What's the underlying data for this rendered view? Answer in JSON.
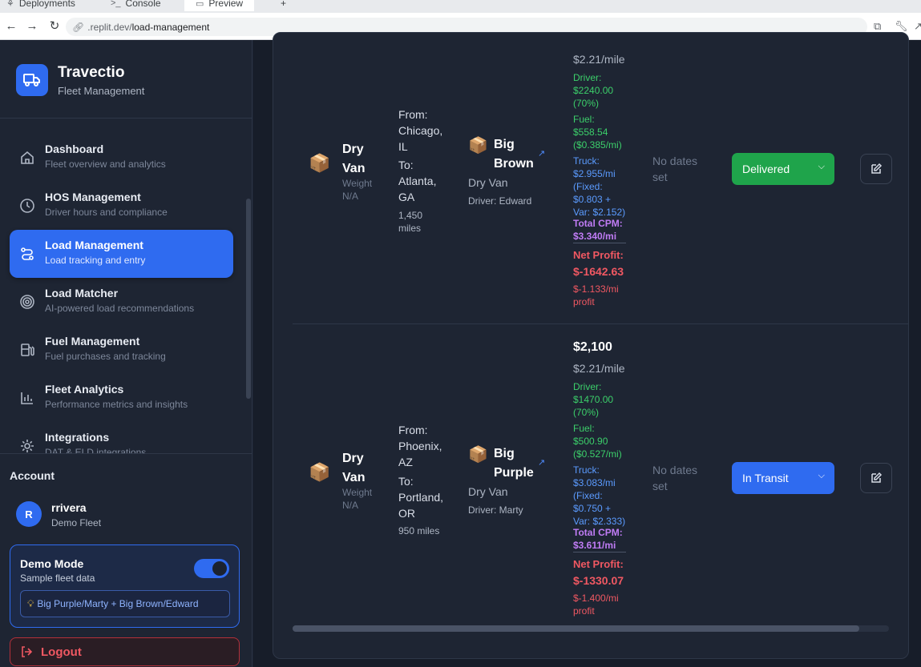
{
  "browser": {
    "tabs": [
      {
        "label": "Deployments",
        "icon": "deploy-icon"
      },
      {
        "label": "Console",
        "icon": "terminal-icon"
      },
      {
        "label": "Preview",
        "icon": "monitor-icon"
      }
    ],
    "new_tab": "+",
    "url_host": ".replit.dev/",
    "url_path": "load-management"
  },
  "sidebar": {
    "brand_name": "Travectio",
    "brand_sub": "Fleet Management",
    "items": [
      {
        "title": "Dashboard",
        "desc": "Fleet overview and analytics",
        "icon": "home-icon",
        "active": false
      },
      {
        "title": "HOS Management",
        "desc": "Driver hours and compliance",
        "icon": "clock-icon",
        "active": false
      },
      {
        "title": "Load Management",
        "desc": "Load tracking and entry",
        "icon": "route-icon",
        "active": true
      },
      {
        "title": "Load Matcher",
        "desc": "AI-powered load recommendations",
        "icon": "target-icon",
        "active": false
      },
      {
        "title": "Fuel Management",
        "desc": "Fuel purchases and tracking",
        "icon": "fuel-icon",
        "active": false
      },
      {
        "title": "Fleet Analytics",
        "desc": "Performance metrics and insights",
        "icon": "bar-chart-icon",
        "active": false
      },
      {
        "title": "Integrations",
        "desc": "DAT & ELD integrations",
        "icon": "gear-icon",
        "active": false
      }
    ],
    "account_label": "Account",
    "user": {
      "initial": "R",
      "name": "rrivera",
      "fleet": "Demo Fleet"
    },
    "demo": {
      "title": "Demo Mode",
      "sub": "Sample fleet data",
      "enabled": true,
      "note": "Big Purple/Marty + Big Brown/Edward"
    },
    "logout": "Logout"
  },
  "loads": [
    {
      "equipment": "Dry Van",
      "weight_label": "Weight",
      "weight": "N/A",
      "from_label": "From:",
      "from": "Chicago, IL",
      "to_label": "To:",
      "to": "Atlanta, GA",
      "miles": "1,450 miles",
      "truck": "Big Brown",
      "truck_type": "Dry Van",
      "driver": "Driver: Edward",
      "rate_per_mile": "$2.21/mile",
      "driver_pay": [
        "Driver:",
        "$2240.00",
        "(70%)"
      ],
      "fuel": [
        "Fuel:",
        "$558.54",
        "($0.385/mi)"
      ],
      "truck_cost": [
        "Truck:",
        "$2.955/mi",
        "(Fixed:",
        "$0.803 +",
        "Var: $2.152)"
      ],
      "cpm": [
        "Total CPM:",
        "$3.340/mi"
      ],
      "profit_label": "Net Profit:",
      "profit": "$-1642.63",
      "profit_mi": [
        "$-1.133/mi",
        "profit"
      ],
      "dates": "No dates set",
      "status": "Delivered",
      "status_color": "#1fa44b"
    },
    {
      "equipment": "Dry Van",
      "weight_label": "Weight",
      "weight": "N/A",
      "from_label": "From:",
      "from": "Phoenix, AZ",
      "to_label": "To:",
      "to": "Portland, OR",
      "miles": "950 miles",
      "truck": "Big Purple",
      "truck_type": "Dry Van",
      "driver": "Driver: Marty",
      "rate": "$2,100",
      "rate_per_mile": "$2.21/mile",
      "driver_pay": [
        "Driver:",
        "$1470.00",
        "(70%)"
      ],
      "fuel": [
        "Fuel:",
        "$500.90",
        "($0.527/mi)"
      ],
      "truck_cost": [
        "Truck:",
        "$3.083/mi",
        "(Fixed:",
        "$0.750 +",
        "Var: $2.333)"
      ],
      "cpm": [
        "Total CPM:",
        "$3.611/mi"
      ],
      "profit_label": "Net Profit:",
      "profit": "$-1330.07",
      "profit_mi": [
        "$-1.400/mi",
        "profit"
      ],
      "dates": "No dates set",
      "status": "In Transit",
      "status_color": "#2f6bf0"
    }
  ],
  "table_scroll_fraction": 0.95
}
